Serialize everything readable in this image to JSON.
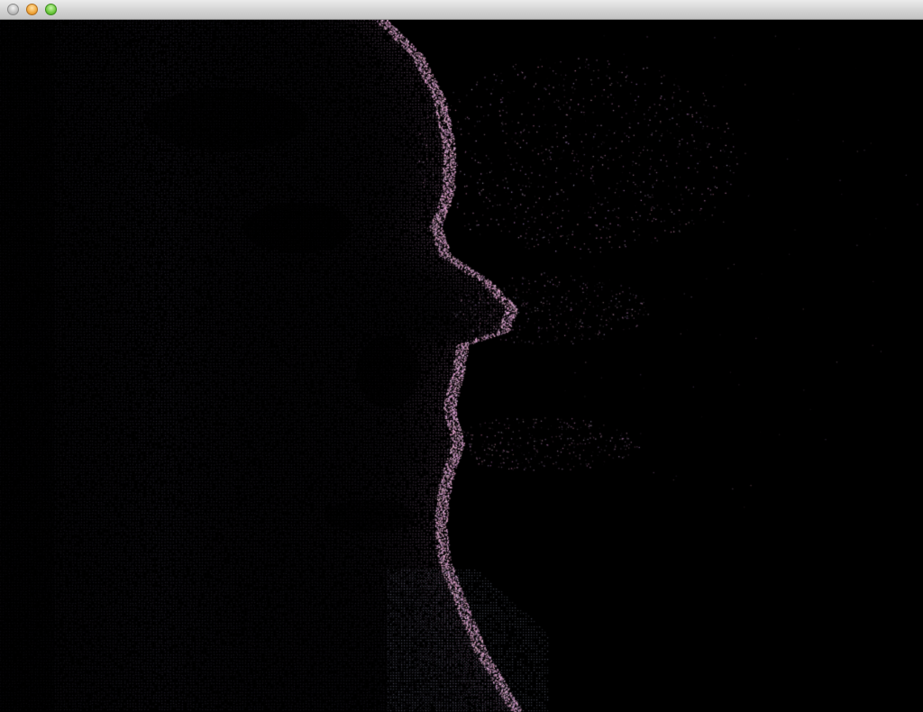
{
  "window": {
    "title": "",
    "controls": {
      "close": "close-button",
      "minimize": "minimize-button",
      "zoom": "zoom-button"
    },
    "control_colors": {
      "close": "#b8b8b8",
      "minimize": "#f0a73b",
      "zoom": "#6cc93d"
    }
  },
  "viewport": {
    "content": "point-cloud-face-profile",
    "background": "#000000",
    "point_colors": [
      "#d7a6c8",
      "#9a86a8",
      "#7d7f98",
      "#b07a8c"
    ]
  }
}
